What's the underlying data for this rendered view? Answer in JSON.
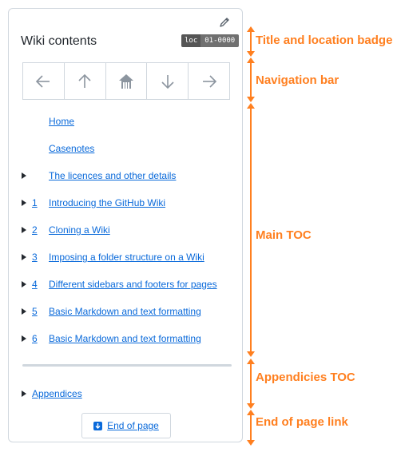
{
  "panel": {
    "title": "Wiki contents",
    "edit_icon": "pencil-icon",
    "location_badge": {
      "key": "loc",
      "value": "01-0000"
    }
  },
  "navbar": {
    "buttons": [
      {
        "icon": "arrow-left-icon"
      },
      {
        "icon": "arrow-up-icon"
      },
      {
        "icon": "home-icon"
      },
      {
        "icon": "arrow-down-icon"
      },
      {
        "icon": "arrow-right-icon"
      }
    ]
  },
  "toc": {
    "items": [
      {
        "number": "",
        "label": "Home",
        "expandable": false
      },
      {
        "number": "",
        "label": "Casenotes",
        "expandable": false
      },
      {
        "number": "",
        "label": "The licences and other details",
        "expandable": true
      },
      {
        "number": "1",
        "label": "Introducing the GitHub Wiki",
        "expandable": true
      },
      {
        "number": "2",
        "label": "Cloning a Wiki",
        "expandable": true
      },
      {
        "number": "3",
        "label": "Imposing a folder structure on a Wiki",
        "expandable": true
      },
      {
        "number": "4",
        "label": "Different sidebars and footers for pages",
        "expandable": true
      },
      {
        "number": "5",
        "label": "Basic Markdown and text formatting",
        "expandable": true
      },
      {
        "number": "6",
        "label": "Basic Markdown and text formatting",
        "expandable": true
      }
    ]
  },
  "appendices": {
    "label": "Appendices"
  },
  "end_of_page": {
    "label": "End of page",
    "icon": "arrow-down-box-icon"
  },
  "annotations": {
    "title_badge": "Title and location badge",
    "navigation_bar": "Navigation bar",
    "main_toc": "Main TOC",
    "appendicies_toc": "Appendicies TOC",
    "end_link": "End of page link"
  },
  "colors": {
    "accent": "#ff7f1f",
    "link": "#0969da",
    "border": "#d0d7de"
  }
}
